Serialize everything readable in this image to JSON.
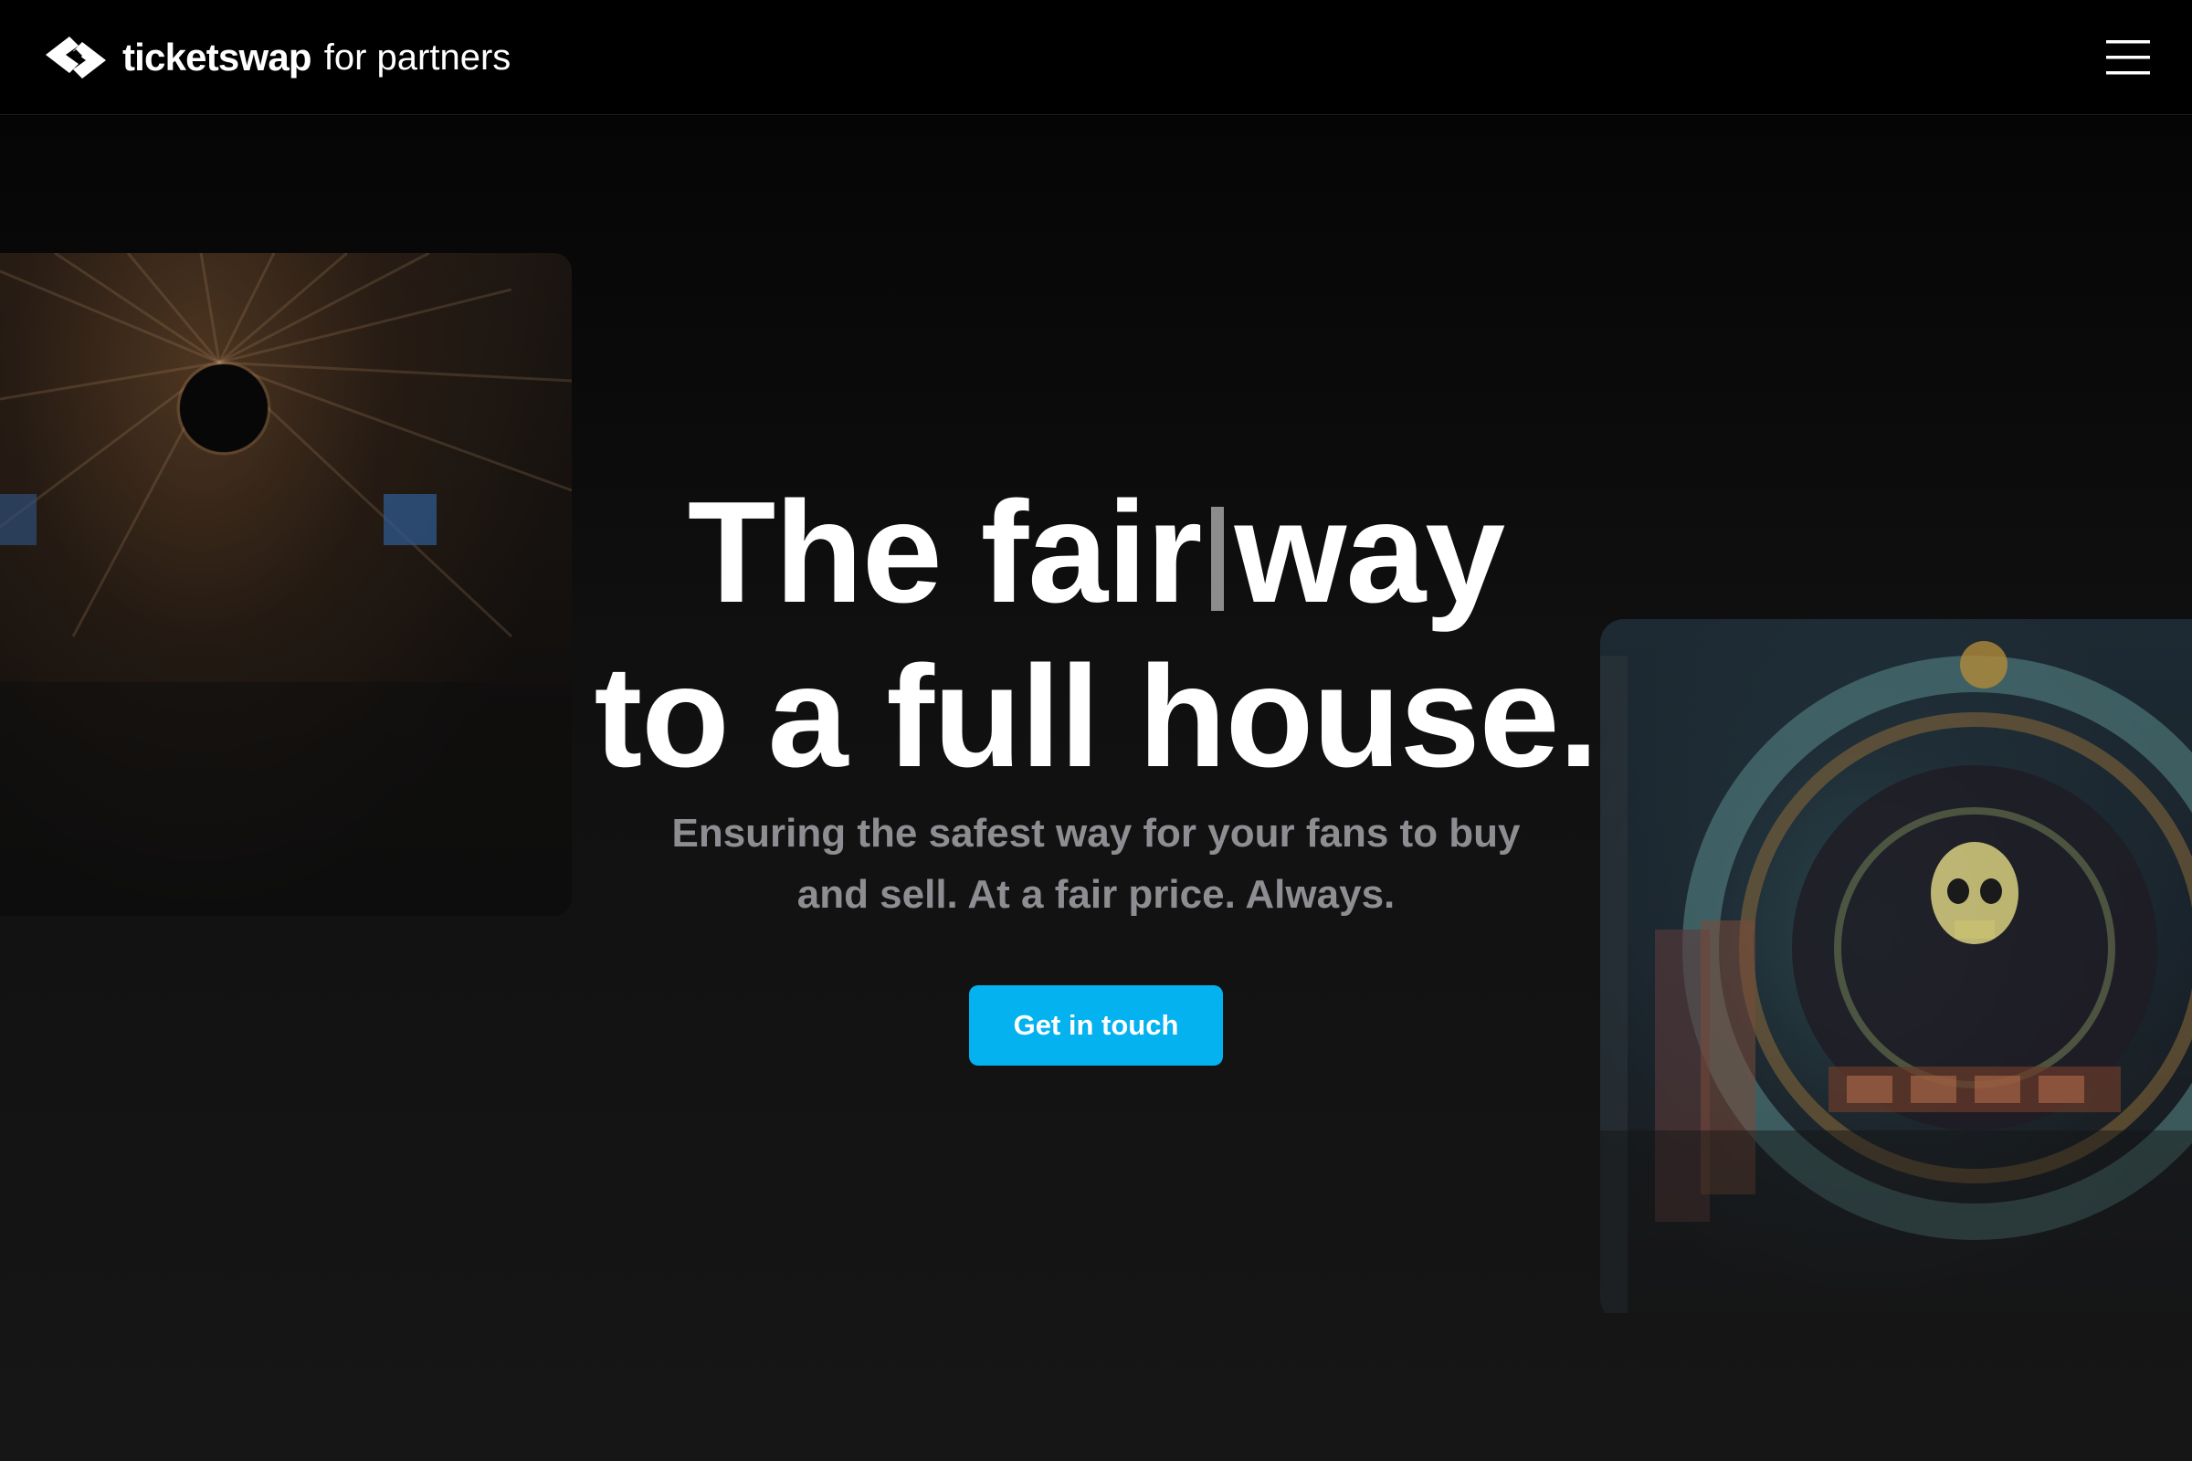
{
  "nav": {
    "brand_name": "ticketswap",
    "brand_sub": "for partners",
    "logo_icon": "ticketswap-logo-icon",
    "menu_icon": "hamburger-menu-icon"
  },
  "hero": {
    "headline_word_1": "The",
    "headline_word_2": "fair",
    "headline_word_3": "way",
    "headline_line_2": "to a full house.",
    "subhead": "Ensuring the safest way for your fans to buy and sell. At a fair price. Always.",
    "cta_label": "Get in touch",
    "left_image": "concert-tent-interior-photo",
    "right_image": "festival-stage-skull-decor-photo"
  },
  "colors": {
    "background": "#000000",
    "text": "#ffffff",
    "subtext": "#8e8e92",
    "accent": "#03b2ef"
  }
}
